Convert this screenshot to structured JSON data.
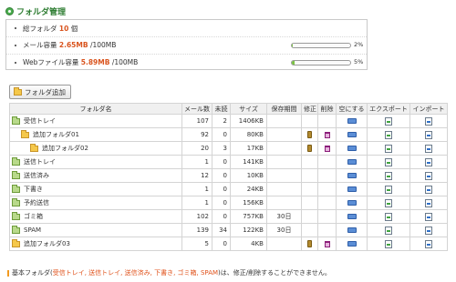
{
  "header": {
    "title": "フォルダ管理"
  },
  "summary": {
    "total_label": "総フォルダ",
    "total_value": "10",
    "total_unit": "個",
    "mail_label": "メール容量",
    "mail_value": "2.65MB",
    "mail_limit": "/100MB",
    "mail_pct": "2%",
    "mail_fill": 0.02,
    "web_label": "Webファイル容量",
    "web_value": "5.89MB",
    "web_limit": "/100MB",
    "web_pct": "5%",
    "web_fill": 0.05
  },
  "toolbar": {
    "add_folder": "フォルダ追加"
  },
  "table": {
    "headers": [
      "フォルダ名",
      "メール数",
      "未読",
      "サイズ",
      "保存期間",
      "修正",
      "削除",
      "空にする",
      "エクスポート",
      "インポート"
    ],
    "rows": [
      {
        "name": "受信トレイ",
        "mails": "107",
        "unread": "2",
        "size": "1406KB",
        "keep": ""
      },
      {
        "name": "追加フォルダ01",
        "mails": "92",
        "unread": "0",
        "size": "80KB",
        "keep": ""
      },
      {
        "name": "追加フォルダ02",
        "mails": "20",
        "unread": "3",
        "size": "17KB",
        "keep": ""
      },
      {
        "name": "送信トレイ",
        "mails": "1",
        "unread": "0",
        "size": "141KB",
        "keep": ""
      },
      {
        "name": "送信済み",
        "mails": "12",
        "unread": "0",
        "size": "10KB",
        "keep": ""
      },
      {
        "name": "下書き",
        "mails": "1",
        "unread": "0",
        "size": "24KB",
        "keep": ""
      },
      {
        "name": "予約送信",
        "mails": "1",
        "unread": "0",
        "size": "156KB",
        "keep": ""
      },
      {
        "name": "ゴミ箱",
        "mails": "102",
        "unread": "0",
        "size": "757KB",
        "keep": "30日"
      },
      {
        "name": "SPAM",
        "mails": "139",
        "unread": "34",
        "size": "122KB",
        "keep": "30日"
      },
      {
        "name": "追加フォルダ03",
        "mails": "5",
        "unread": "0",
        "size": "4KB",
        "keep": ""
      }
    ]
  },
  "footer": {
    "note_prefix": "基本フォルダ(",
    "note_folders": "受信トレイ, 送信トレイ, 送信済み, 下書き, ゴミ箱, SPAM",
    "note_suffix": ")は、修正/削除することができません。"
  },
  "icons": {
    "title": "circle-bullet-icon",
    "folder": "folder-icon",
    "edit": "pencil-icon",
    "delete": "trash-icon",
    "empty": "empty-folder-icon",
    "export": "export-icon",
    "import": "import-icon"
  },
  "colors": {
    "accent": "#2e7d32",
    "value": "#d9541e",
    "bar": "#7ac143"
  }
}
